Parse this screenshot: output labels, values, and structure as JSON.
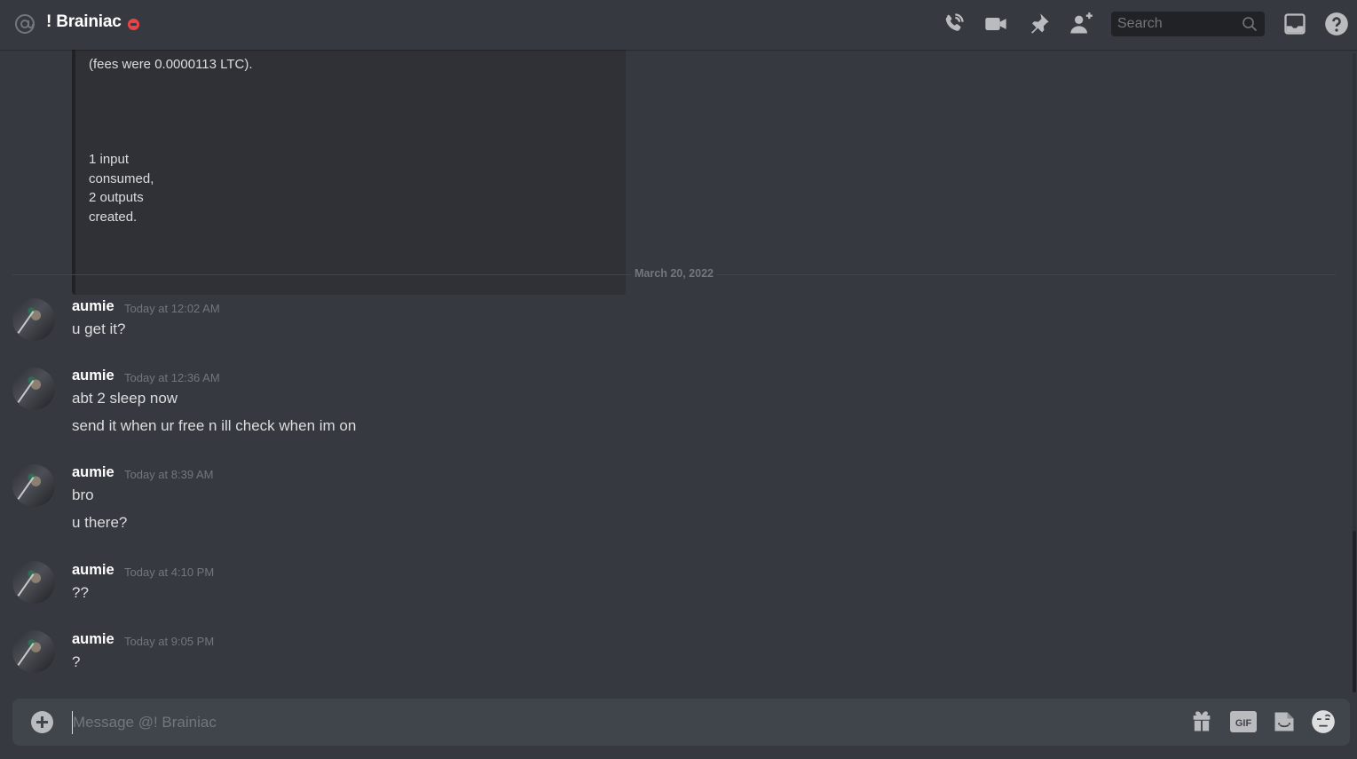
{
  "header": {
    "title": "! Brainiac",
    "status": "do-not-disturb",
    "status_color": "#ed4245",
    "icons": [
      "at-icon",
      "voice-call-icon",
      "video-call-icon",
      "pinned-messages-icon",
      "add-friend-icon",
      "inbox-icon",
      "help-icon"
    ],
    "search_placeholder": "Search"
  },
  "embed": {
    "lines": [
      "(fees were 0.0000113 LTC).",
      "1 input",
      "consumed,",
      "2 outputs",
      "created."
    ]
  },
  "divider": {
    "date": "March 20, 2022"
  },
  "messages": [
    {
      "author": "aumie",
      "timestamp": "Today at 12:02 AM",
      "lines": [
        "u get it?"
      ]
    },
    {
      "author": "aumie",
      "timestamp": "Today at 12:36 AM",
      "lines": [
        "abt 2 sleep now",
        "send it when ur free n ill check when im on"
      ]
    },
    {
      "author": "aumie",
      "timestamp": "Today at 8:39 AM",
      "lines": [
        "bro",
        "u there?"
      ]
    },
    {
      "author": "aumie",
      "timestamp": "Today at 4:10 PM",
      "lines": [
        "??"
      ]
    },
    {
      "author": "aumie",
      "timestamp": "Today at 9:05 PM",
      "lines": [
        "?"
      ]
    }
  ],
  "composer": {
    "placeholder": "Message @! Brainiac",
    "value": "",
    "gif_label": "GIF",
    "icons": [
      "attach-plus-icon",
      "gift-icon",
      "gif-icon",
      "sticker-icon",
      "emoji-icon"
    ]
  },
  "colors": {
    "background": "#36393f",
    "embed_background": "#2f3136",
    "composer_background": "#40444b",
    "muted_text": "#72767d",
    "icon": "#b9bbbe"
  }
}
